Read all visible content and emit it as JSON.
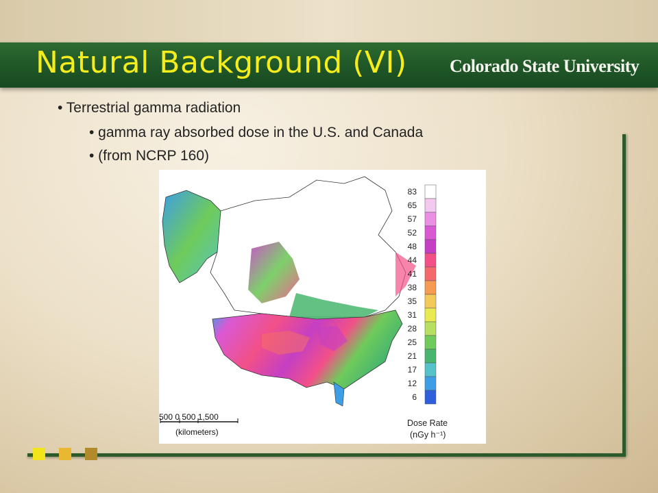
{
  "slide": {
    "title": "Natural Background (VI)",
    "logo_text": "Colorado State University",
    "bullets": {
      "level1": "• Terrestrial gamma radiation",
      "level2_a": "• gamma ray absorbed dose in the U.S. and Canada",
      "level2_b": "• (from NCRP 160)"
    }
  },
  "map": {
    "scale_numbers": "500   0   500       1,500",
    "scale_unit": "(kilometers)",
    "legend": {
      "title_line1": "Dose Rate",
      "title_line2": "(nGy h⁻¹)",
      "labels": [
        "83",
        "65",
        "57",
        "52",
        "48",
        "44",
        "41",
        "38",
        "35",
        "31",
        "28",
        "25",
        "21",
        "17",
        "12",
        "6"
      ],
      "colors": [
        "#ffffff",
        "#f4c9ef",
        "#ec8fe4",
        "#d959d4",
        "#c53fc4",
        "#f25087",
        "#f46a6a",
        "#f59b52",
        "#f3c95a",
        "#e9ea4f",
        "#b7e060",
        "#6fcb5a",
        "#49b66e",
        "#55c3c9",
        "#3d9ee6",
        "#2f5fdb"
      ]
    }
  },
  "colors": {
    "title": "#f4ec1d",
    "title_bar": "#1f5627",
    "squares": [
      "#f2e51c",
      "#e8b832",
      "#b38a2b"
    ]
  }
}
